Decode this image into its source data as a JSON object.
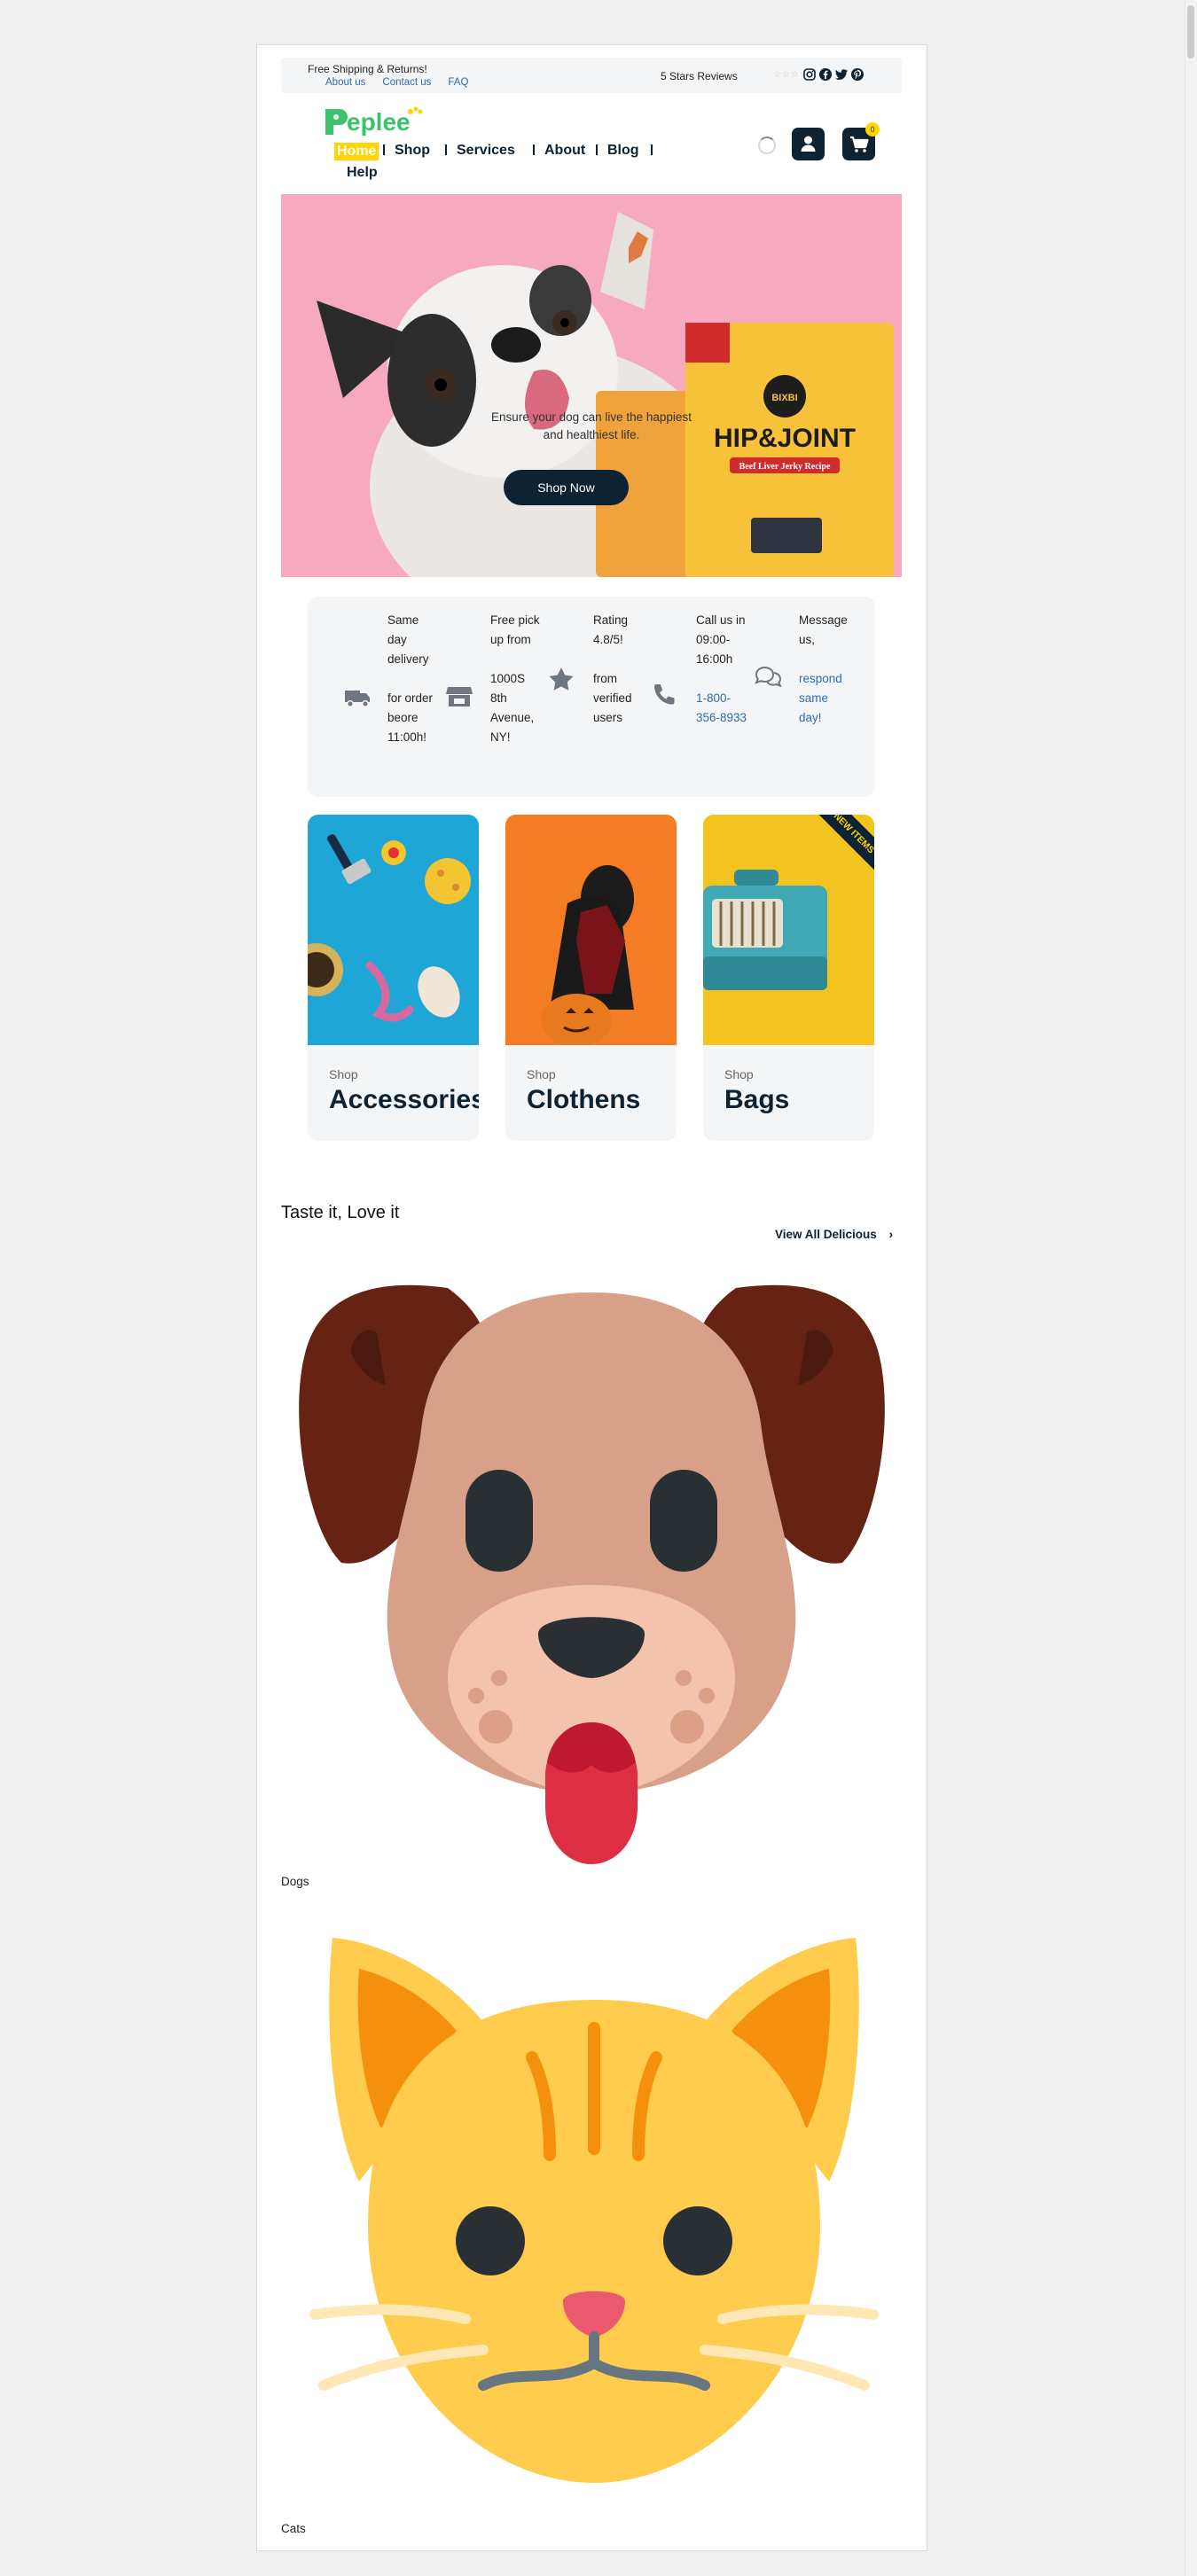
{
  "topbar": {
    "shipping": "Free Shipping & Returns!",
    "links": [
      "About us",
      "Contact us",
      "FAQ"
    ],
    "reviews": "5 Stars Reviews",
    "stars_filled": 0,
    "stars_total": 5,
    "social": [
      "instagram-icon",
      "facebook-icon",
      "twitter-icon",
      "pinterest-icon"
    ]
  },
  "logo": {
    "text": "eplee",
    "brand_color": "#3cc16c"
  },
  "nav": {
    "items": [
      "Home",
      "Shop",
      "Services",
      "About",
      "Blog",
      "Help"
    ],
    "active": "Home",
    "active_color": "#ffd400"
  },
  "header": {
    "cart_count": "0"
  },
  "hero": {
    "text": "Ensure your dog can live the happiest and healthiest life.",
    "cta": "Shop Now",
    "bg_color": "#f7aabf",
    "product_brand": "BIXBI",
    "product_name": "HIP&JOINT",
    "product_sub": "Beef Liver Jerky Recipe"
  },
  "features": [
    {
      "icon": "truck-icon",
      "title": "Same day delivery",
      "desc": "for order beore 11:00h!"
    },
    {
      "icon": "store-icon",
      "title": "Free pick up from",
      "desc": "1000S 8th Avenue, NY!"
    },
    {
      "icon": "star-icon",
      "title": "Rating 4.8/5!",
      "desc": "from verified users"
    },
    {
      "icon": "phone-icon",
      "title": "Call us in 09:00-16:00h",
      "desc": "1-800-356-8933"
    },
    {
      "icon": "chat-icon",
      "title": "Message us,",
      "desc": "respond same day!"
    }
  ],
  "categories": [
    {
      "small": "Shop",
      "big": "Accessories"
    },
    {
      "small": "Shop",
      "big": "Clothens"
    },
    {
      "small": "Shop",
      "big": "Bags",
      "badge": "NEW ITEMS"
    }
  ],
  "section": {
    "title": "Taste it, Love it",
    "view_all": "View All Delicious"
  },
  "pets": [
    "Dogs",
    "Cats"
  ],
  "colors": {
    "navy": "#0d2233",
    "yellow": "#ffd400",
    "link": "#2a6db0"
  }
}
